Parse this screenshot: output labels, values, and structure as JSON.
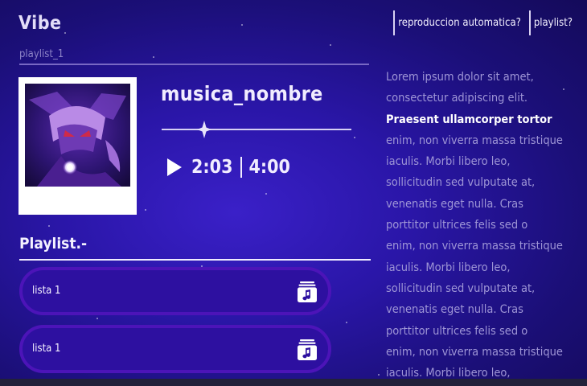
{
  "app": {
    "title": "Vibe"
  },
  "header": {
    "nav": [
      {
        "label": "reproduccion automatica?"
      },
      {
        "label": "playlist?"
      }
    ]
  },
  "player": {
    "playlist_name": "playlist_1",
    "song_title": "musica_nombre",
    "current_time": "2:03",
    "total_time": "4:00",
    "progress": 0.2
  },
  "playlist_section": {
    "heading": "Playlist.-",
    "items": [
      {
        "label": "lista 1",
        "icon": "music-library-icon"
      },
      {
        "label": "lista 1",
        "icon": "music-library-icon"
      }
    ]
  },
  "side_text": {
    "line1": "Lorem ipsum dolor sit amet,",
    "line2": "consectetur adipiscing elit.",
    "highlight": "Praesent ullamcorper tortor",
    "line4": "enim, non viverra massa tristique",
    "line5": "iaculis. Morbi  libero leo,",
    "line6": "sollicitudin sed vulputate at,",
    "line7": "venenatis eget nulla. Cras",
    "line8": "porttitor ultrices felis sed o",
    "line9": "enim, non viverra massa tristique",
    "line10": "iaculis. Morbi  libero leo,",
    "line11": "sollicitudin sed vulputate at,",
    "line12": "venenatis eget nulla. Cras",
    "line13": "porttitor ultrices felis sed o",
    "line14": "enim, non viverra massa tristique",
    "line15": "iaculis. Morbi  libero leo,"
  },
  "colors": {
    "background": "#2a16a8",
    "accent": "#4c14b8",
    "text_muted": "#9e95d6"
  }
}
